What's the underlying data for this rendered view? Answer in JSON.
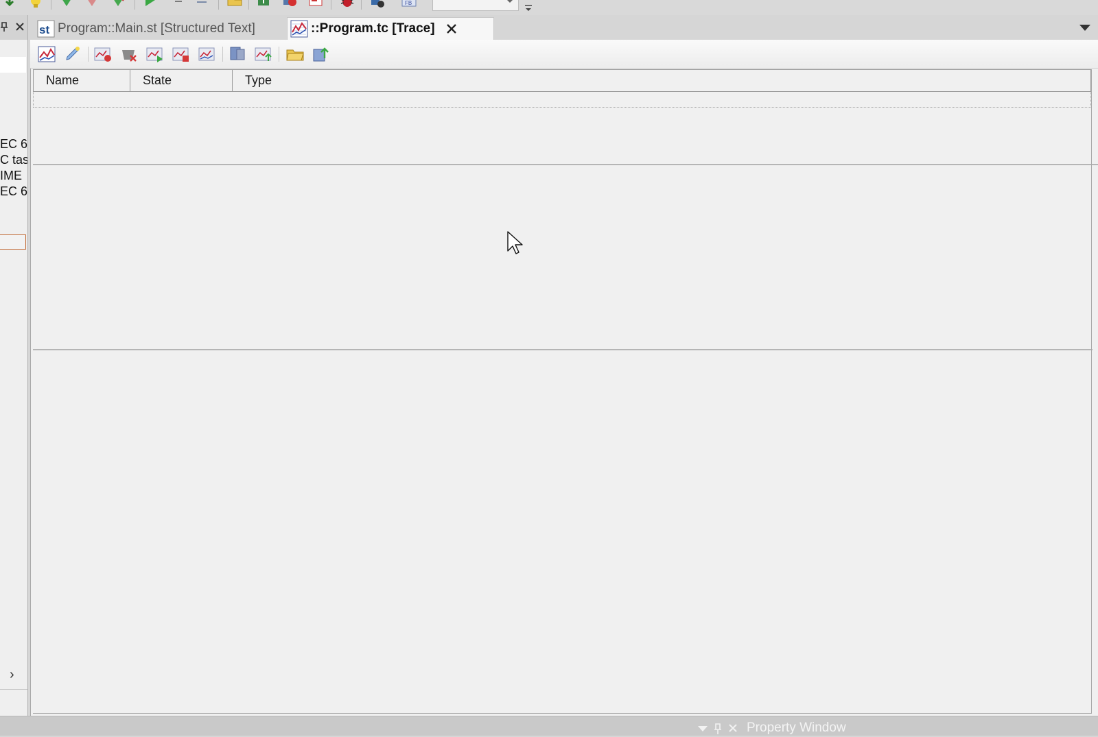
{
  "toolbar": {
    "icons": [
      "download-arrow-icon",
      "lightbulb-icon",
      "green-check-shield-icon",
      "red-shield-icon",
      "green-arrow-shield-icon",
      "run-play-icon",
      "step-lines-icon",
      "step-back-icon",
      "folder-icon",
      "download-to-device-icon",
      "online-connect-icon",
      "compile-icon",
      "debug-bug-icon",
      "network-device-icon",
      "function-block-icon"
    ],
    "mode_combo_value": ""
  },
  "left_panel": {
    "text_lines": [
      "EC 6",
      "C tas",
      "IME",
      "EC 6"
    ],
    "expand_glyph": "›"
  },
  "tabs": [
    {
      "icon": "structured-text-icon",
      "label": "Program::Main.st [Structured Text]",
      "active": false
    },
    {
      "icon": "trace-chart-icon",
      "label": "::Program.tc [Trace]",
      "active": true
    }
  ],
  "trace_toolbar": {
    "icons": [
      "trace-chart-icon",
      "edit-pencil-icon",
      "add-trace-icon",
      "delete-trace-icon",
      "start-trace-icon",
      "stop-trace-icon",
      "reset-trace-icon",
      "monitor-icon",
      "export-chart-icon",
      "open-folder-icon",
      "upload-icon"
    ]
  },
  "grid": {
    "columns": [
      "Name",
      "State",
      "Type"
    ],
    "rows": []
  },
  "bottom_bar": {
    "title": "Property Window"
  },
  "colors": {
    "chrome": "#d6d6d6",
    "panel": "#f0f0f0",
    "accent_orange": "#c0662f",
    "status_bar_text": "#f4f4f4"
  }
}
